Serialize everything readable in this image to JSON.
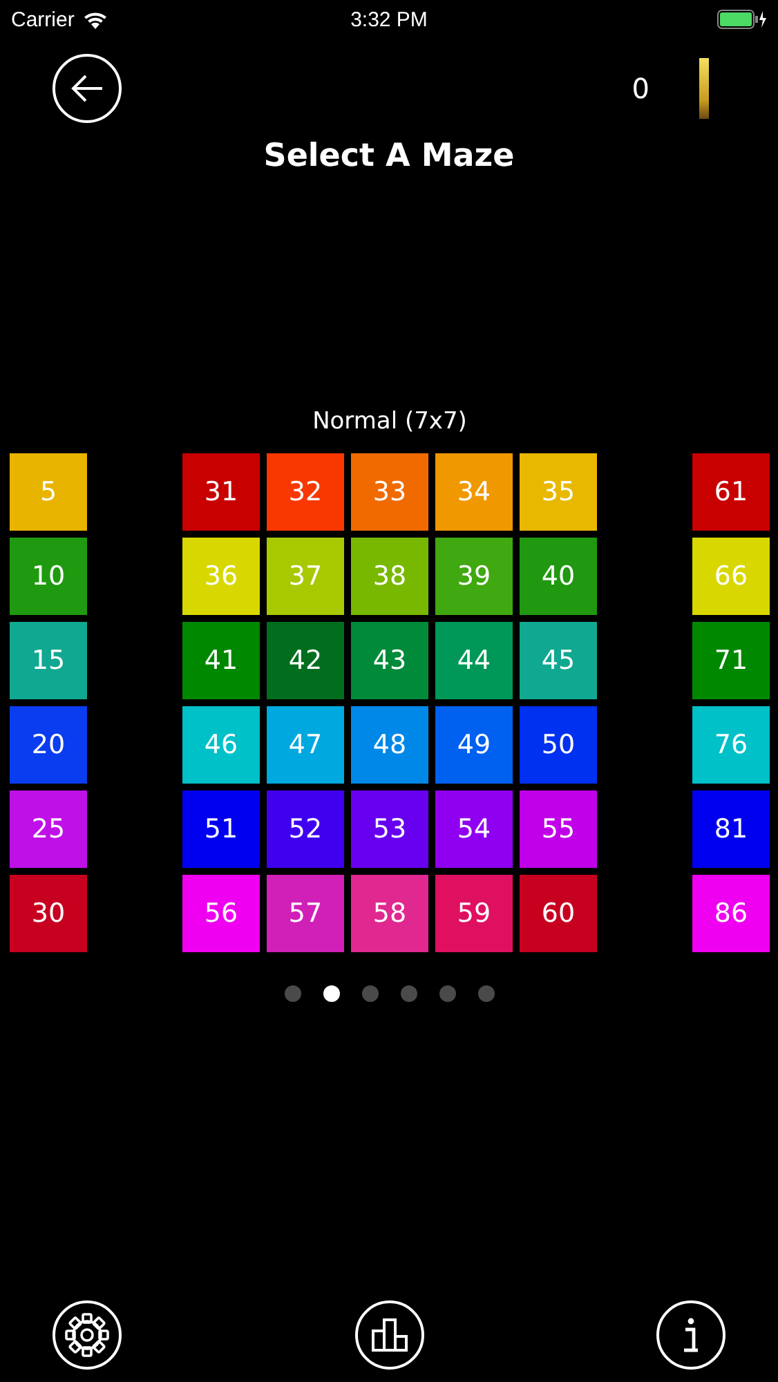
{
  "status_bar": {
    "carrier": "Carrier",
    "time": "3:32 PM"
  },
  "header": {
    "score": "0",
    "title": "Select A Maze"
  },
  "pages": [
    {
      "columns": [
        [
          {
            "label": "5",
            "color": "#e8b400"
          },
          {
            "label": "10",
            "color": "#1f9a10"
          },
          {
            "label": "15",
            "color": "#10a890"
          },
          {
            "label": "20",
            "color": "#0a3cf0"
          },
          {
            "label": "25",
            "color": "#c010e8"
          },
          {
            "label": "30",
            "color": "#c80020"
          }
        ]
      ]
    },
    {
      "label": "Normal (7x7)",
      "columns": [
        [
          {
            "label": "31",
            "color": "#c80000"
          },
          {
            "label": "36",
            "color": "#d8d800"
          },
          {
            "label": "41",
            "color": "#008800"
          },
          {
            "label": "46",
            "color": "#00c0c8"
          },
          {
            "label": "51",
            "color": "#0000f0"
          },
          {
            "label": "56",
            "color": "#f000f0"
          }
        ],
        [
          {
            "label": "32",
            "color": "#f83800"
          },
          {
            "label": "37",
            "color": "#a8c800"
          },
          {
            "label": "42",
            "color": "#006e1e"
          },
          {
            "label": "47",
            "color": "#00a8e0"
          },
          {
            "label": "52",
            "color": "#4000f0"
          },
          {
            "label": "57",
            "color": "#d020b8"
          }
        ],
        [
          {
            "label": "33",
            "color": "#f06a00"
          },
          {
            "label": "38",
            "color": "#78b800"
          },
          {
            "label": "43",
            "color": "#008a3a"
          },
          {
            "label": "48",
            "color": "#0088e8"
          },
          {
            "label": "53",
            "color": "#6800f0"
          },
          {
            "label": "58",
            "color": "#e02890"
          }
        ],
        [
          {
            "label": "34",
            "color": "#f09800"
          },
          {
            "label": "39",
            "color": "#40a810"
          },
          {
            "label": "44",
            "color": "#009858"
          },
          {
            "label": "49",
            "color": "#0060f0"
          },
          {
            "label": "54",
            "color": "#9000f0"
          },
          {
            "label": "59",
            "color": "#e01060"
          }
        ],
        [
          {
            "label": "35",
            "color": "#e8b800"
          },
          {
            "label": "40",
            "color": "#209810"
          },
          {
            "label": "45",
            "color": "#10a890"
          },
          {
            "label": "50",
            "color": "#0030f0"
          },
          {
            "label": "55",
            "color": "#c000e8"
          },
          {
            "label": "60",
            "color": "#c80020"
          }
        ]
      ]
    },
    {
      "columns": [
        [
          {
            "label": "61",
            "color": "#c80000"
          },
          {
            "label": "66",
            "color": "#d8d800"
          },
          {
            "label": "71",
            "color": "#008800"
          },
          {
            "label": "76",
            "color": "#00c0c8"
          },
          {
            "label": "81",
            "color": "#0000f0"
          },
          {
            "label": "86",
            "color": "#f000f0"
          }
        ]
      ]
    }
  ],
  "page_dots": [
    {
      "selected": false
    },
    {
      "selected": true
    },
    {
      "selected": false
    },
    {
      "selected": false
    },
    {
      "selected": false
    },
    {
      "selected": false
    }
  ]
}
